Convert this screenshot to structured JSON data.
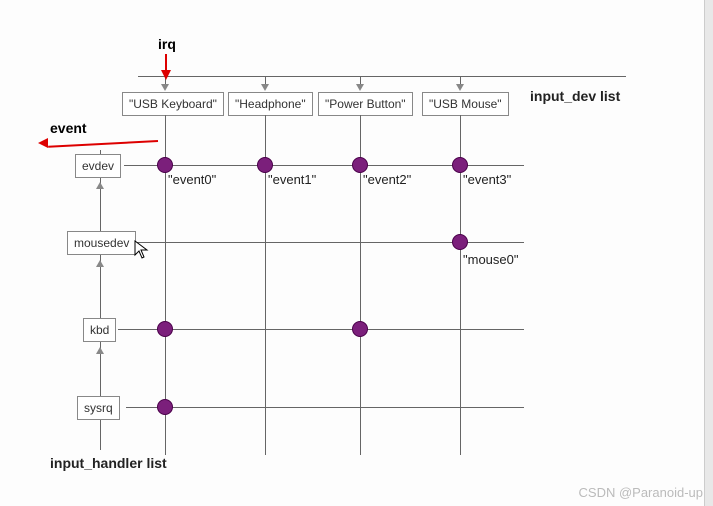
{
  "labels": {
    "irq": "irq",
    "event": "event",
    "input_dev_list": "input_dev list",
    "input_handler_list": "input_handler list"
  },
  "devices": {
    "usb_keyboard": "\"USB Keyboard\"",
    "headphone": "\"Headphone\"",
    "power_button": "\"Power Button\"",
    "usb_mouse": "\"USB Mouse\""
  },
  "handlers": {
    "evdev": "evdev",
    "mousedev": "mousedev",
    "kbd": "kbd",
    "sysrq": "sysrq"
  },
  "events": {
    "event0": "\"event0\"",
    "event1": "\"event1\"",
    "event2": "\"event2\"",
    "event3": "\"event3\"",
    "mouse0": "\"mouse0\""
  },
  "watermark": "CSDN @Paranoid-up",
  "chart_data": {
    "type": "grid-intersection",
    "columns": [
      "USB Keyboard",
      "Headphone",
      "Power Button",
      "USB Mouse"
    ],
    "rows": [
      "evdev",
      "mousedev",
      "kbd",
      "sysrq"
    ],
    "intersections": [
      {
        "row": "evdev",
        "col": "USB Keyboard",
        "label": "event0"
      },
      {
        "row": "evdev",
        "col": "Headphone",
        "label": "event1"
      },
      {
        "row": "evdev",
        "col": "Power Button",
        "label": "event2"
      },
      {
        "row": "evdev",
        "col": "USB Mouse",
        "label": "event3"
      },
      {
        "row": "mousedev",
        "col": "USB Mouse",
        "label": "mouse0"
      },
      {
        "row": "kbd",
        "col": "USB Keyboard"
      },
      {
        "row": "kbd",
        "col": "Power Button"
      },
      {
        "row": "sysrq",
        "col": "USB Keyboard"
      }
    ],
    "annotations": {
      "irq_arrow": "red arrow labelled irq pointing down into USB Keyboard",
      "event_arrow": "red arrow labelled event pointing left out of evdev row"
    },
    "axis_labels": {
      "top_right": "input_dev list",
      "bottom_left": "input_handler list"
    }
  }
}
